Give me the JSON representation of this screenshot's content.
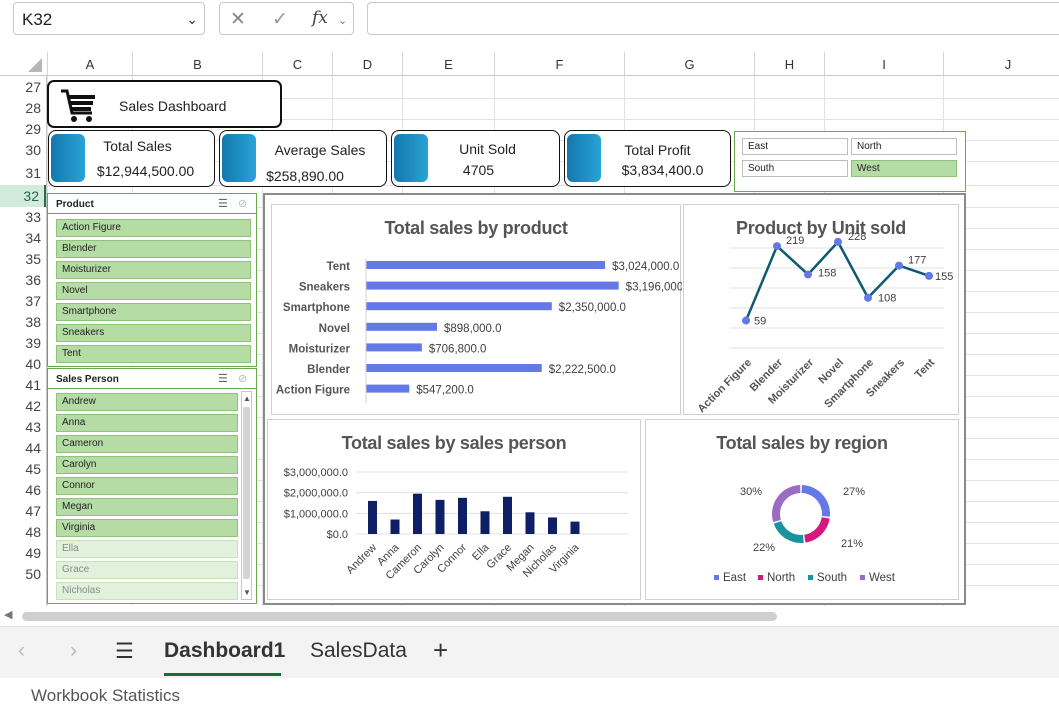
{
  "formula_bar": {
    "name_box": "K32",
    "formula": ""
  },
  "columns": [
    "A",
    "B",
    "C",
    "D",
    "E",
    "F",
    "G",
    "H",
    "I",
    "J"
  ],
  "rows": [
    "27",
    "28",
    "29",
    "30",
    "31",
    "32",
    "33",
    "34",
    "35",
    "36",
    "37",
    "38",
    "39",
    "40",
    "41",
    "42",
    "43",
    "44",
    "45",
    "46",
    "47",
    "48",
    "49",
    "50"
  ],
  "selected_row": "32",
  "dashboard": {
    "title": "Sales Dashboard",
    "kpis": [
      {
        "title": "Total Sales",
        "value": "$12,944,500.00"
      },
      {
        "title": "Average Sales",
        "value": "$258,890.00"
      },
      {
        "title": "Unit Sold",
        "value": "4705"
      },
      {
        "title": "Total Profit",
        "value": "$3,834,400.0"
      }
    ],
    "region_slicer": [
      {
        "label": "East",
        "selected": false
      },
      {
        "label": "North",
        "selected": false
      },
      {
        "label": "South",
        "selected": false
      },
      {
        "label": "West",
        "selected": true
      }
    ],
    "product_slicer": {
      "header": "Product",
      "items": [
        "Action Figure",
        "Blender",
        "Moisturizer",
        "Novel",
        "Smartphone",
        "Sneakers",
        "Tent"
      ]
    },
    "salesperson_slicer": {
      "header": "Sales Person",
      "items": [
        {
          "label": "Andrew",
          "selected": true
        },
        {
          "label": "Anna",
          "selected": true
        },
        {
          "label": "Cameron",
          "selected": true
        },
        {
          "label": "Carolyn",
          "selected": true
        },
        {
          "label": "Connor",
          "selected": true
        },
        {
          "label": "Megan",
          "selected": true
        },
        {
          "label": "Virginia",
          "selected": true
        },
        {
          "label": "Ella",
          "selected": false
        },
        {
          "label": "Grace",
          "selected": false
        },
        {
          "label": "Nicholas",
          "selected": false
        }
      ]
    }
  },
  "chart_data": [
    {
      "type": "bar",
      "orientation": "horizontal",
      "title": "Total sales by product",
      "categories": [
        "Tent",
        "Sneakers",
        "Smartphone",
        "Novel",
        "Moisturizer",
        "Blender",
        "Action Figure"
      ],
      "values": [
        3024000,
        3196000,
        2350000,
        898000,
        706800,
        2222500,
        547200
      ],
      "labels": [
        "$3,024,000.0",
        "$3,196,000.0",
        "$2,350,000.0",
        "$898,000.0",
        "$706,800.0",
        "$2,222,500.0",
        "$547,200.0"
      ],
      "color": "#6478e6"
    },
    {
      "type": "line",
      "title": "Product by Unit sold",
      "categories": [
        "Action Figure",
        "Blender",
        "Moisturizer",
        "Novel",
        "Smartphone",
        "Sneakers",
        "Tent"
      ],
      "values": [
        59,
        219,
        158,
        228,
        108,
        177,
        155
      ],
      "ylim": [
        0,
        260
      ],
      "color": "#0e5a73",
      "marker_color": "#6478e6"
    },
    {
      "type": "bar",
      "title": "Total sales by sales person",
      "categories": [
        "Andrew",
        "Anna",
        "Cameron",
        "Carolyn",
        "Connor",
        "Ella",
        "Grace",
        "Megan",
        "Nicholas",
        "Virginia"
      ],
      "values": [
        1600000,
        700000,
        1950000,
        1650000,
        1750000,
        1100000,
        1800000,
        1050000,
        800000,
        600000
      ],
      "yticks": [
        "$3,000,000.0",
        "$2,000,000.0",
        "$1,000,000.0",
        "$0.0"
      ],
      "ylim": [
        0,
        3000000
      ],
      "color": "#0e1f66"
    },
    {
      "type": "pie",
      "donut": true,
      "title": "Total sales by region",
      "categories": [
        "East",
        "North",
        "South",
        "West"
      ],
      "values": [
        27,
        21,
        22,
        30
      ],
      "labels": [
        "27%",
        "21%",
        "22%",
        "30%"
      ],
      "colors": [
        "#6478e6",
        "#d6177f",
        "#1a93a0",
        "#9a6cc4"
      ],
      "legend": "bottom"
    }
  ],
  "sheet_tabs": {
    "items": [
      "Dashboard1",
      "SalesData"
    ],
    "active": "Dashboard1"
  },
  "status": {
    "text": "Workbook Statistics"
  }
}
